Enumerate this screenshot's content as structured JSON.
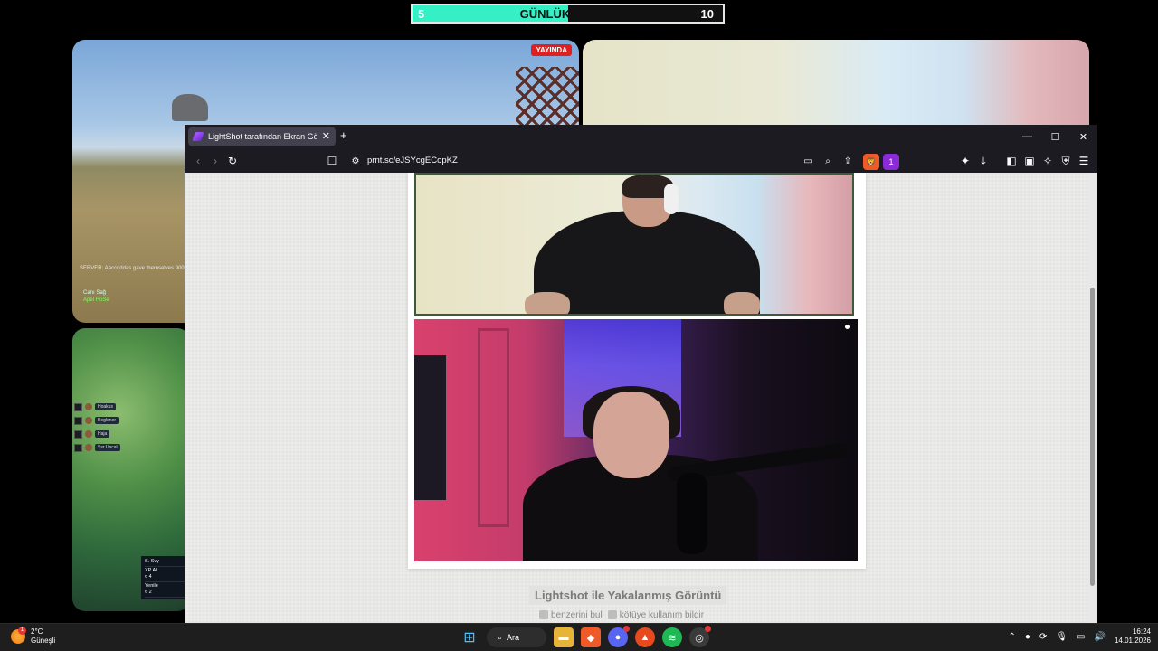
{
  "overlay": {
    "goal": {
      "current": "5",
      "title": "GÜNLÜK ABONE",
      "target": "10",
      "progress_fraction": 0.5
    },
    "game_panel": {
      "live_badge": "YAYINDA",
      "server_message": "SERVER: Aaccoddas gave themselves 9000",
      "hud_line1": "Canı Sağ",
      "hud_line2": "Apel HoSe"
    },
    "tft_panel": {
      "players": [
        "Hoakus",
        "Beglener",
        "Haja",
        "Ssr Uncal"
      ],
      "scores": [
        {
          "name": "S. Svy",
          "value": ""
        },
        {
          "name": "XP Al",
          "value": "4"
        },
        {
          "name": "Yenile",
          "value": "2"
        }
      ]
    }
  },
  "browser": {
    "tab_title": "LightShot tarafından Ekran Görüntüsü",
    "new_tab_label": "+",
    "url": "prnt.sc/eJSYcgECopKZ",
    "window_controls": {
      "minimize": "—",
      "maximize": "☐",
      "close": "✕"
    },
    "extension_badge_count": "1",
    "page": {
      "caption": "Lightshot ile Yakalanmış Görüntü",
      "link_find_similar": "benzerini bul",
      "link_report": "kötüye kullanım bildir"
    }
  },
  "taskbar": {
    "weather_temp": "2°C",
    "weather_desc": "Güneşli",
    "weather_badge": "1",
    "search_label": "Ara",
    "time": "16:24",
    "date": "14.01.2026"
  }
}
